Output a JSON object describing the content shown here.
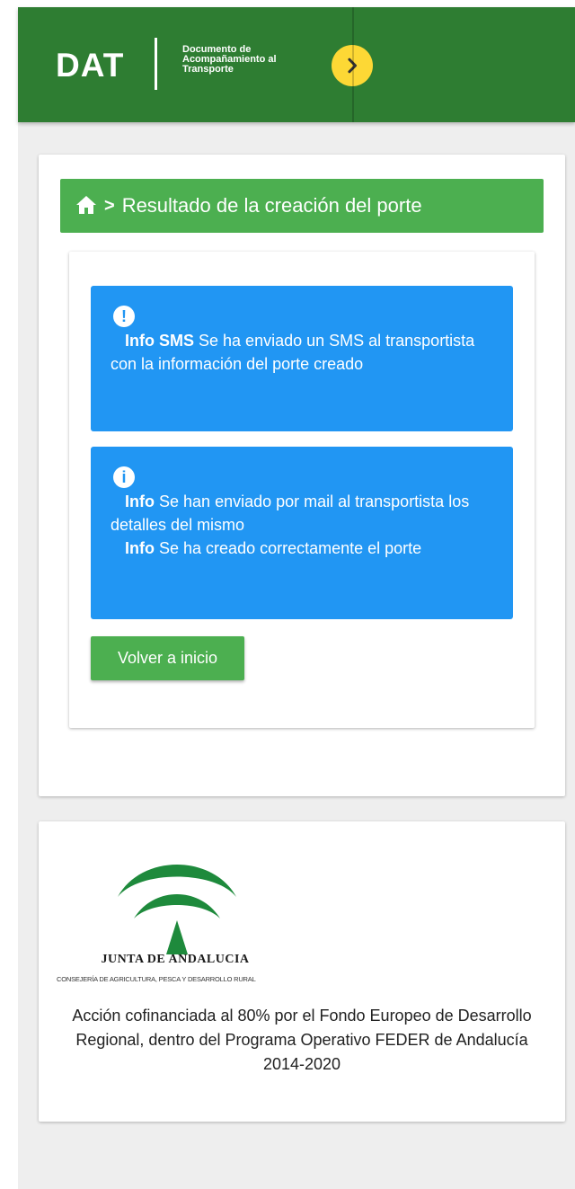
{
  "header": {
    "logo": "DAT",
    "subtitle": "Documento de\nAcompañamiento al\nTransporte",
    "accent_color": "#2e7d32",
    "toggle_icon": "chevron-right-icon",
    "toggle_color": "#fdd835"
  },
  "breadcrumb": {
    "home_icon": "home-icon",
    "separator": ">",
    "title": "Resultado de la creación del porte"
  },
  "alerts": [
    {
      "icon": "exclamation-icon",
      "icon_char": "!",
      "color": "#2196f3",
      "label": "Info SMS",
      "text": "Se ha enviado un SMS al transportista con la información del porte creado"
    },
    {
      "icon": "info-icon",
      "icon_char": "i",
      "color": "#2196f3",
      "messages": [
        {
          "label": "Info",
          "text": "Se han enviado por mail al transportista los detalles del mismo"
        },
        {
          "label": "Info",
          "text": "Se ha creado correctamente el porte"
        }
      ]
    }
  ],
  "actions": {
    "back_button": "Volver a inicio"
  },
  "footer": {
    "institution": "JUNTA DE ANDALUCIA",
    "department": "CONSEJERÍA DE AGRICULTURA, PESCA Y DESARROLLO RURAL",
    "funding_text": "Acción cofinanciada al 80% por el Fondo Europeo de Desarrollo Regional, dentro del Programa Operativo FEDER de Andalucía 2014-2020"
  }
}
